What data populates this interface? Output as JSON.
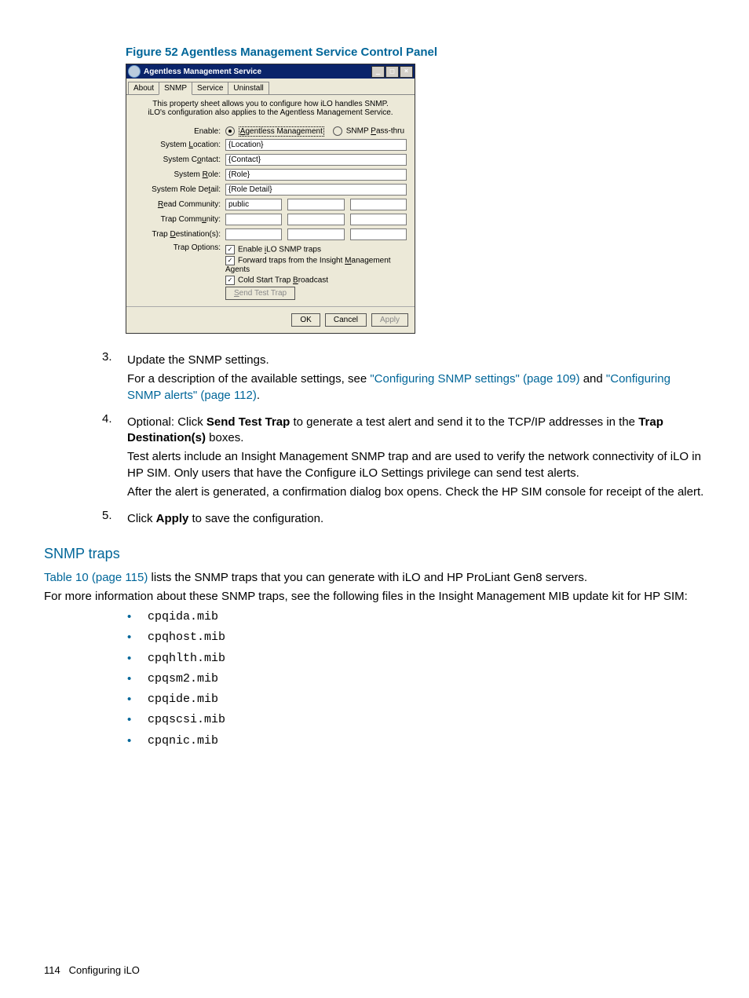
{
  "figure": {
    "caption": "Figure 52 Agentless Management Service Control Panel"
  },
  "dialog": {
    "title": "Agentless Management Service",
    "tabs": [
      "About",
      "SNMP",
      "Service",
      "Uninstall"
    ],
    "activeTab": 1,
    "description1": "This property sheet allows you to configure how iLO handles SNMP.",
    "description2": "iLO's configuration also applies to the Agentless Management Service.",
    "enable_label": "Enable:",
    "radio_agentless": "Agentless Management",
    "radio_passthru": "SNMP Pass-thru",
    "fields": {
      "location_label": "System Location:",
      "location_value": "{Location}",
      "contact_label": "System Contact:",
      "contact_value": "{Contact}",
      "role_label": "System Role:",
      "role_value": "{Role}",
      "role_detail_label": "System Role Detail:",
      "role_detail_value": "{Role Detail}",
      "read_community_label": "Read Community:",
      "read_community_value": "public",
      "trap_community_label": "Trap Community:",
      "trap_destinations_label": "Trap Destination(s):"
    },
    "trapopts": {
      "label": "Trap Options:",
      "enable_traps": "Enable iLO SNMP traps",
      "forward": "Forward traps from the Insight Management Agents",
      "coldstart": "Cold Start Trap Broadcast",
      "send_test": "Send Test Trap"
    },
    "buttons": {
      "ok": "OK",
      "cancel": "Cancel",
      "apply": "Apply"
    }
  },
  "steps": {
    "s3": {
      "num": "3.",
      "line1": "Update the SNMP settings.",
      "line2a": "For a description of the available settings, see ",
      "link1": "\"Configuring SNMP settings\" (page 109)",
      "line2b": " and ",
      "link2": "\"Configuring SNMP alerts\" (page 112)",
      "line2c": "."
    },
    "s4": {
      "num": "4.",
      "p1a": "Optional: Click ",
      "p1_bold1": "Send Test Trap",
      "p1b": " to generate a test alert and send it to the TCP/IP addresses in the ",
      "p1_bold2": "Trap Destination(s)",
      "p1c": " boxes.",
      "p2": "Test alerts include an Insight Management SNMP trap and are used to verify the network connectivity of iLO in HP SIM. Only users that have the Configure iLO Settings privilege can send test alerts.",
      "p3": "After the alert is generated, a confirmation dialog box opens. Check the HP SIM console for receipt of the alert."
    },
    "s5": {
      "num": "5.",
      "p1a": "Click ",
      "p1_bold": "Apply",
      "p1b": " to save the configuration."
    }
  },
  "section": {
    "title": "SNMP traps",
    "p1a": "",
    "link": "Table 10 (page 115)",
    "p1b": " lists the SNMP traps that you can generate with iLO and HP ProLiant Gen8 servers.",
    "p2": "For more information about these SNMP traps, see the following files in the Insight Management MIB update kit for HP SIM:",
    "mibs": [
      "cpqida.mib",
      "cpqhost.mib",
      "cpqhlth.mib",
      "cpqsm2.mib",
      "cpqide.mib",
      "cpqscsi.mib",
      "cpqnic.mib"
    ]
  },
  "footer": {
    "page": "114",
    "label": "Configuring iLO"
  }
}
